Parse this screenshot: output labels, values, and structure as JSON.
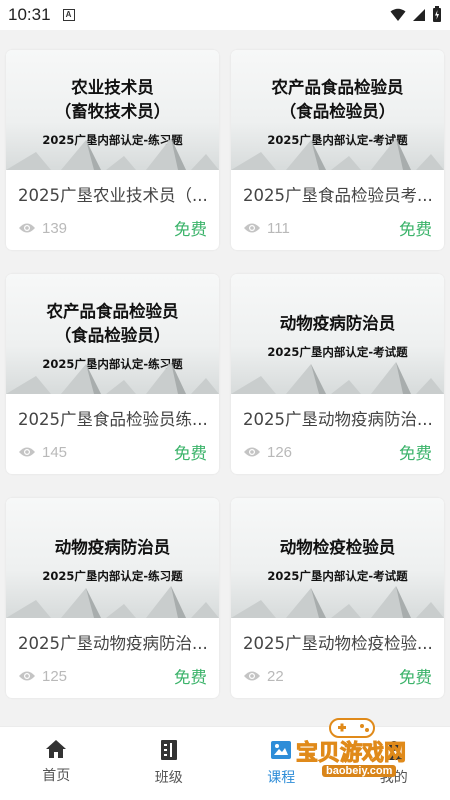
{
  "status": {
    "time": "10:31"
  },
  "cards": [
    {
      "thumb_line1": "农业技术员",
      "thumb_line2": "（畜牧技术员）",
      "thumb_sub": "2025广垦内部认定-练习题",
      "title": "2025广垦农业技术员（...",
      "views": "139",
      "price": "免费"
    },
    {
      "thumb_line1": "农产品食品检验员",
      "thumb_line2": "（食品检验员）",
      "thumb_sub": "2025广垦内部认定-考试题",
      "title": "2025广垦食品检验员考...",
      "views": "111",
      "price": "免费"
    },
    {
      "thumb_line1": "农产品食品检验员",
      "thumb_line2": "（食品检验员）",
      "thumb_sub": "2025广垦内部认定-练习题",
      "title": "2025广垦食品检验员练...",
      "views": "145",
      "price": "免费"
    },
    {
      "thumb_line1": "动物疫病防治员",
      "thumb_line2": "",
      "thumb_sub": "2025广垦内部认定-考试题",
      "title": "2025广垦动物疫病防治...",
      "views": "126",
      "price": "免费"
    },
    {
      "thumb_line1": "动物疫病防治员",
      "thumb_line2": "",
      "thumb_sub": "2025广垦内部认定-练习题",
      "title": "2025广垦动物疫病防治...",
      "views": "125",
      "price": "免费"
    },
    {
      "thumb_line1": "动物检疫检验员",
      "thumb_line2": "",
      "thumb_sub": "2025广垦内部认定-考试题",
      "title": "2025广垦动物检疫检验...",
      "views": "22",
      "price": "免费"
    }
  ],
  "tabs": [
    {
      "label": "首页",
      "icon": "home-icon"
    },
    {
      "label": "班级",
      "icon": "class-icon"
    },
    {
      "label": "课程",
      "icon": "course-icon"
    },
    {
      "label": "我的",
      "icon": "profile-icon"
    }
  ],
  "active_tab": "课程",
  "watermark": {
    "title": "宝贝游戏网",
    "url": "baobeiy.com"
  },
  "colors": {
    "price": "#3bb36a",
    "active_tab": "#2e8dd8",
    "views": "#b9b9b9"
  }
}
